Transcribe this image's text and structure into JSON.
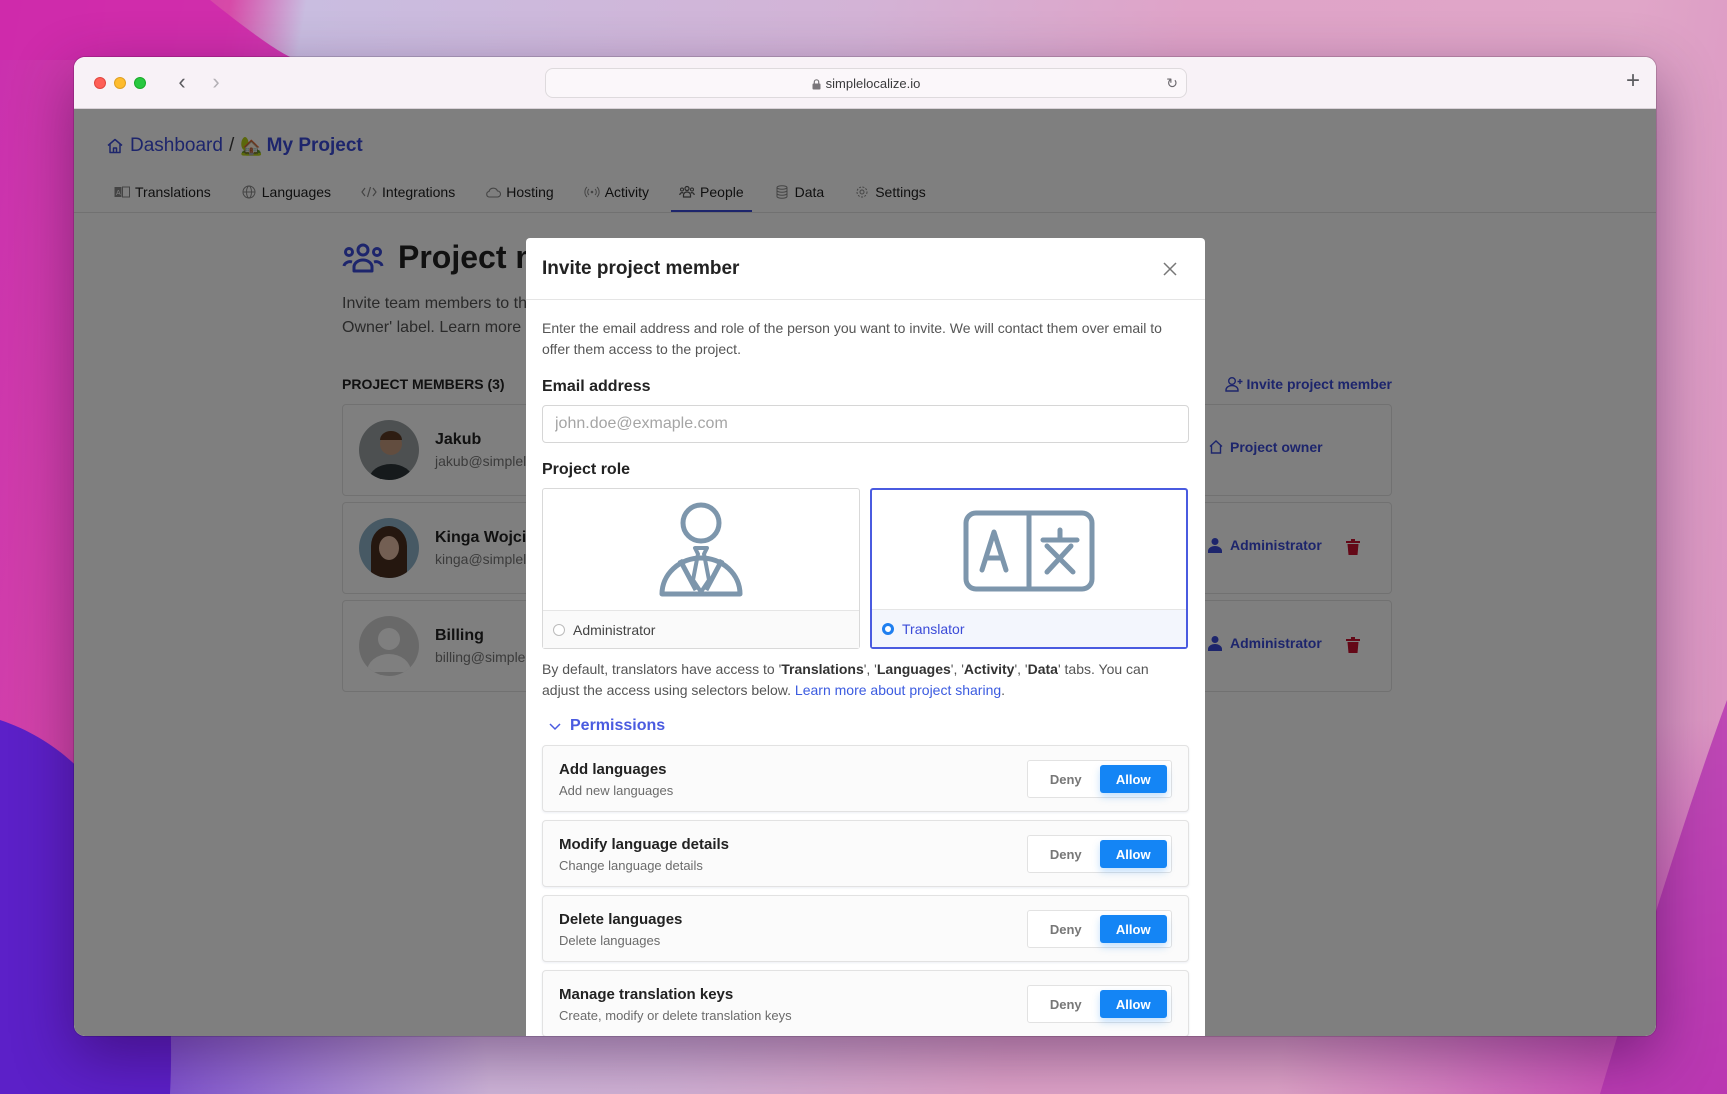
{
  "browser": {
    "url": "simplelocalize.io",
    "back_label": "‹",
    "forward_label": "›",
    "reload_icon": "↻",
    "new_tab_label": "+"
  },
  "breadcrumb": {
    "home_label": "Dashboard",
    "separator": "/",
    "project_emoji": "🏡",
    "project_label": "My Project"
  },
  "tabs": [
    {
      "label": "Translations",
      "icon": "translate-icon",
      "glyph": "▭"
    },
    {
      "label": "Languages",
      "icon": "globe-icon",
      "glyph": "⊕"
    },
    {
      "label": "Integrations",
      "icon": "code-icon",
      "glyph": "</>"
    },
    {
      "label": "Hosting",
      "icon": "cloud-icon",
      "glyph": "☁"
    },
    {
      "label": "Activity",
      "icon": "broadcast-icon",
      "glyph": "((•))"
    },
    {
      "label": "People",
      "icon": "people-icon",
      "glyph": "👥",
      "active": true
    },
    {
      "label": "Data",
      "icon": "database-icon",
      "glyph": "▤"
    },
    {
      "label": "Settings",
      "icon": "gear-icon",
      "glyph": "⚙"
    }
  ],
  "page": {
    "title": "Project members",
    "description_line1": "Invite team members to the project. You can transfer project ownership by clicking on the 'Project",
    "description_line2": "Owner' label. Learn more",
    "members_heading": "PROJECT MEMBERS (3)",
    "invite_link": "Invite project member",
    "members": [
      {
        "name": "Jakub",
        "email": "jakub@simplelocalize.io",
        "role": "Project owner",
        "role_icon": "home-icon",
        "deletable": false
      },
      {
        "name": "Kinga Wojciechowska",
        "email": "kinga@simplelocalize.io",
        "role": "Administrator",
        "role_icon": "user-icon",
        "deletable": true
      },
      {
        "name": "Billing",
        "email": "billing@simplelocalize.io",
        "role": "Administrator",
        "role_icon": "user-icon",
        "deletable": true
      }
    ]
  },
  "modal": {
    "title": "Invite project member",
    "intro": "Enter the email address and role of the person you want to invite. We will contact them over email to offer them access to the project.",
    "email_label": "Email address",
    "email_value": "",
    "email_placeholder": "john.doe@exmaple.com",
    "role_label": "Project role",
    "roles": [
      {
        "label": "Administrator",
        "selected": false
      },
      {
        "label": "Translator",
        "selected": true
      }
    ],
    "note_prefix": "By default, translators have access to ",
    "note_tabs": [
      "Translations",
      "Languages",
      "Activity",
      "Data"
    ],
    "note_suffix": " tabs. You can adjust the access using selectors below. ",
    "note_link": "Learn more about project sharing",
    "permissions_label": "Permissions",
    "permissions_expanded": true,
    "deny_label": "Deny",
    "allow_label": "Allow",
    "permissions": [
      {
        "title": "Add languages",
        "description": "Add new languages",
        "value": "Allow"
      },
      {
        "title": "Modify language details",
        "description": "Change language details",
        "value": "Allow"
      },
      {
        "title": "Delete languages",
        "description": "Delete languages",
        "value": "Allow"
      },
      {
        "title": "Manage translation keys",
        "description": "Create, modify or delete translation keys",
        "value": "Allow"
      }
    ]
  },
  "colors": {
    "accent": "#3b4bd8",
    "selected_border": "#4a5be0",
    "allow_active": "#1485f5",
    "danger": "#c8102e",
    "icon_gray": "#7d96ac"
  }
}
